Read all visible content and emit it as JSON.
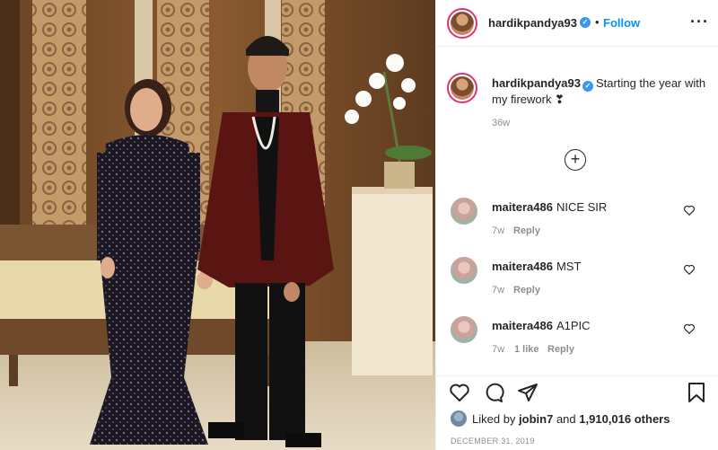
{
  "post": {
    "author": "hardikpandya93",
    "follow_label": "Follow",
    "dot": "•",
    "more_icon": "more-horizontal-icon",
    "caption": {
      "username": "hardikpandya93",
      "text": "Starting the year with my firework ❣"
    },
    "caption_age": "36w"
  },
  "comments": [
    {
      "username": "maitera486",
      "text": "NICE SIR",
      "age": "7w",
      "likes": "",
      "reply": "Reply"
    },
    {
      "username": "maitera486",
      "text": "MST",
      "age": "7w",
      "likes": "",
      "reply": "Reply"
    },
    {
      "username": "maitera486",
      "text": "A1PIC",
      "age": "7w",
      "likes": "1 like",
      "reply": "Reply"
    }
  ],
  "likes": {
    "liked_by_prefix": "Liked by",
    "liked_by_user": "jobin7",
    "and": "and",
    "count": "1,910,016 others"
  },
  "date": "DECEMBER 31, 2019",
  "colors": {
    "follow_blue": "#0095f6",
    "verified_blue": "#3897f0",
    "muted_gray": "#8e8e8e",
    "text": "#262626"
  }
}
